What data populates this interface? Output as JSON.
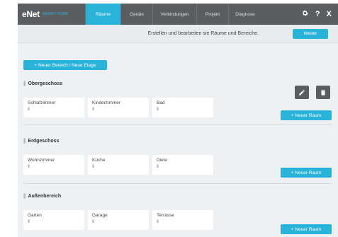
{
  "app": {
    "logo_main": "eNet",
    "logo_sub": "SMART HOME",
    "tabs": [
      {
        "label": "Räume",
        "active": true
      },
      {
        "label": "Geräte",
        "active": false
      },
      {
        "label": "Verbindungen",
        "active": false
      },
      {
        "label": "Projekt",
        "active": false
      },
      {
        "label": "Diagnose",
        "active": false
      }
    ],
    "icons": {
      "settings": "gear-icon",
      "help_label": "?",
      "close_label": "X"
    },
    "accent_color": "#2ab3d9",
    "header_color": "#5b5e61"
  },
  "subbar": {
    "instruction": "Erstellen und bearbeiten sie Räume und Bereiche.",
    "next_label": "Weiter"
  },
  "toolbar": {
    "new_area_label": "+ Neuer Bereich / Neue Etage",
    "edit_icon": "pencil-icon",
    "delete_icon": "trash-icon"
  },
  "sections": [
    {
      "title": "Obergeschoss",
      "new_room_label": "+ Neuer Raum",
      "rooms": [
        {
          "name": "Schlafzimmer",
          "meta": "III"
        },
        {
          "name": "Kinderzimmer",
          "meta": "III"
        },
        {
          "name": "Bad",
          "meta": "III"
        }
      ]
    },
    {
      "title": "Erdgeschoss",
      "new_room_label": "+ Neuer Raum",
      "rooms": [
        {
          "name": "Wohnzimmer",
          "meta": "III"
        },
        {
          "name": "Küche",
          "meta": "III"
        },
        {
          "name": "Diele",
          "meta": "III"
        }
      ]
    },
    {
      "title": "Außenbereich",
      "new_room_label": "+ Neuer Raum",
      "rooms": [
        {
          "name": "Garten",
          "meta": "III"
        },
        {
          "name": "Garage",
          "meta": "III"
        },
        {
          "name": "Terrasse",
          "meta": "III"
        }
      ]
    }
  ]
}
